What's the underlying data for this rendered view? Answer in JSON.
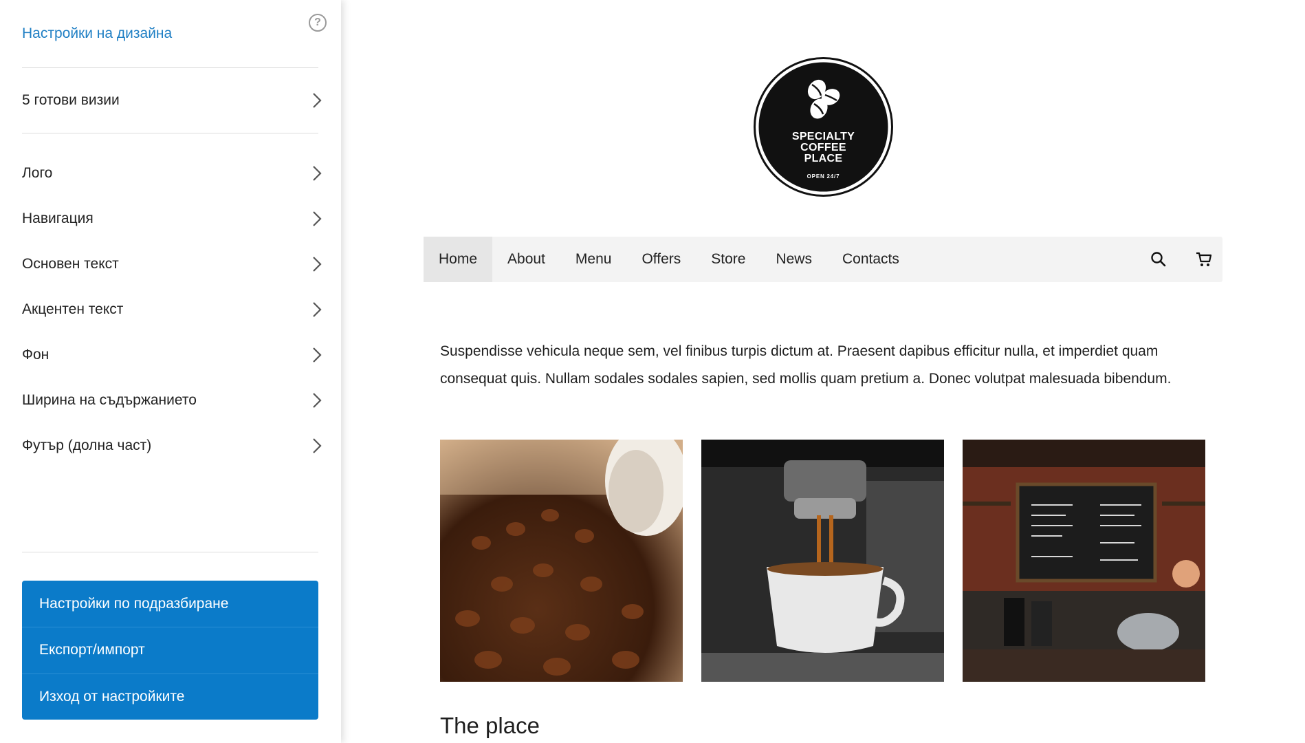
{
  "sidebar": {
    "title": "Настройки на дизайна",
    "help_icon": "help-icon",
    "presets_label": "5 готови визии",
    "items": [
      {
        "label": "Лого"
      },
      {
        "label": "Навигация"
      },
      {
        "label": "Основен текст"
      },
      {
        "label": "Акцентен текст"
      },
      {
        "label": "Фон"
      },
      {
        "label": "Ширина на съдържанието"
      },
      {
        "label": "Футър (долна част)"
      }
    ],
    "actions": [
      {
        "label": "Настройки по подразбиране"
      },
      {
        "label": "Експорт/импорт"
      },
      {
        "label": "Изход от настройките"
      }
    ],
    "accent_color": "#0b7bc9",
    "title_color": "#1f7fc4"
  },
  "preview": {
    "logo": {
      "line1": "SPECIALTY",
      "line2": "COFFEE",
      "line3": "PLACE",
      "sub": "OPEN 24/7"
    },
    "nav": {
      "items": [
        "Home",
        "About",
        "Menu",
        "Offers",
        "Store",
        "News",
        "Contacts"
      ],
      "active": "Home",
      "icons": [
        "search-icon",
        "cart-icon"
      ]
    },
    "body_text": "Suspendisse vehicula neque sem, vel finibus turpis dictum at. Praesent dapibus efficitur nulla, et imperdiet quam consequat quis. Nullam sodales sodales sapien, sed mollis quam pretium a. Donec volutpat malesuada bibendum.",
    "section_title": "The place"
  }
}
